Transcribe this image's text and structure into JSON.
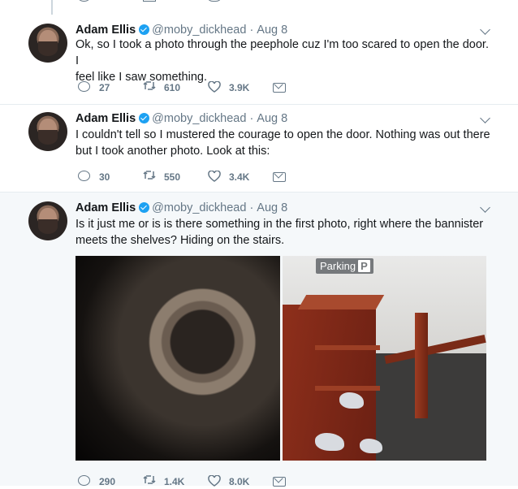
{
  "tweets": [
    {
      "author": "Adam Ellis",
      "handle": "@moby_dickhead",
      "date": "Aug 8",
      "text_lines": [
        "Ok, so I took a photo through the peephole cuz I'm too scared to open the door. I",
        "feel like I saw something."
      ],
      "replies": "27",
      "retweets": "610",
      "likes": "3.9K"
    },
    {
      "author": "Adam Ellis",
      "handle": "@moby_dickhead",
      "date": "Aug 8",
      "text_lines": [
        "I couldn't tell so I mustered the courage to open the door. Nothing was out there",
        "but I took another photo. Look at this:"
      ],
      "replies": "30",
      "retweets": "550",
      "likes": "3.4K"
    },
    {
      "author": "Adam Ellis",
      "handle": "@moby_dickhead",
      "date": "Aug 8",
      "text_lines": [
        "Is it just me or is is there something in the first photo, right where the bannister",
        "meets the shelves? Hiding on the stairs."
      ],
      "replies": "290",
      "retweets": "1.4K",
      "likes": "8.0K",
      "photo_sign": "Parking",
      "photo_sign_box": "P"
    }
  ],
  "separator": "·",
  "colors": {
    "verified": "#1da1f2",
    "meta": "#657786",
    "highlight_bg": "#f5f8fa"
  }
}
